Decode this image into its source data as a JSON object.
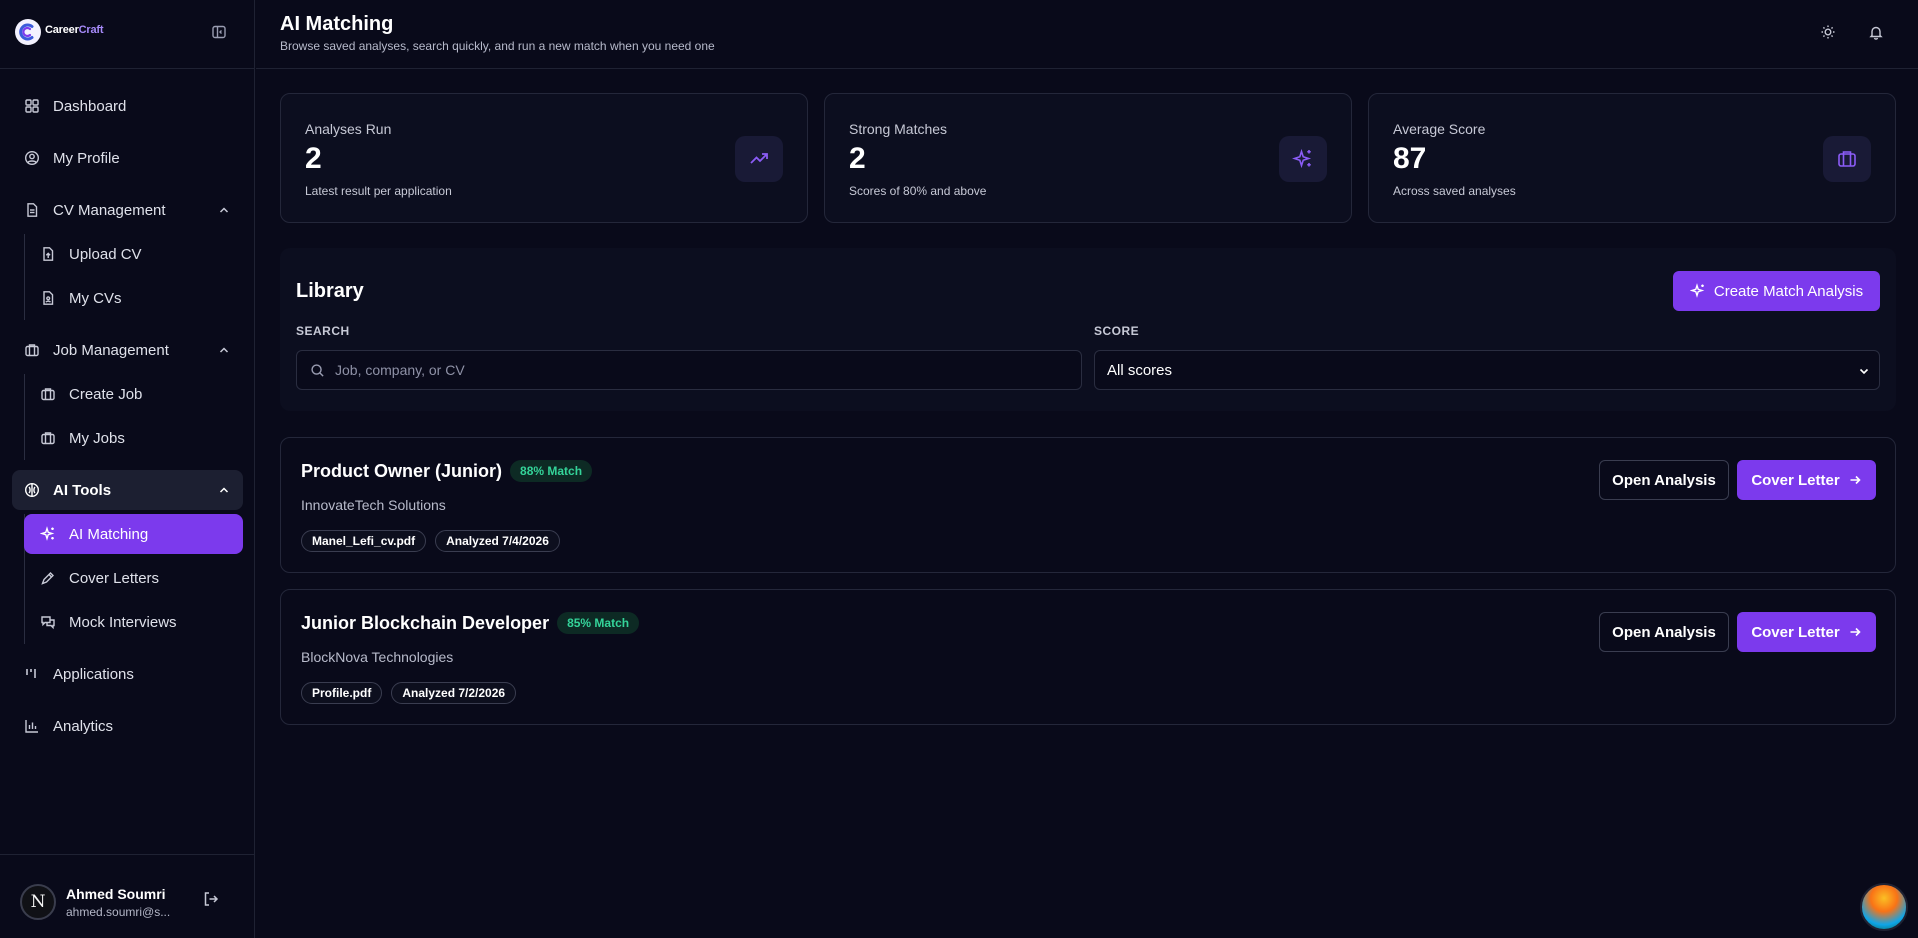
{
  "app": {
    "brand_prefix": "Career",
    "brand_suffix": "Craft",
    "brand_tagline": ""
  },
  "sidebar": {
    "dashboard": "Dashboard",
    "profile": "My Profile",
    "cv_group": "CV Management",
    "upload_cv": "Upload CV",
    "my_cvs": "My CVs",
    "job_group": "Job Management",
    "create_job": "Create Job",
    "my_jobs": "My Jobs",
    "ai_group": "AI Tools",
    "ai_matching": "AI Matching",
    "cover_letters": "Cover Letters",
    "mock_interviews": "Mock Interviews",
    "applications": "Applications",
    "analytics": "Analytics"
  },
  "user": {
    "initial": "N",
    "name": "Ahmed Soumri",
    "email": "ahmed.soumri@s..."
  },
  "header": {
    "title": "AI Matching",
    "subtitle": "Browse saved analyses, search quickly, and run a new match when you need one"
  },
  "stats": [
    {
      "label": "Analyses Run",
      "value": "2",
      "sub": "Latest result per application",
      "icon": "trending-up-icon"
    },
    {
      "label": "Strong Matches",
      "value": "2",
      "sub": "Scores of 80% and above",
      "icon": "sparkles-icon"
    },
    {
      "label": "Average Score",
      "value": "87",
      "sub": "Across saved analyses",
      "icon": "briefcase-icon"
    }
  ],
  "library": {
    "title": "Library",
    "create_button": "Create Match Analysis",
    "search_label": "SEARCH",
    "search_placeholder": "Job, company, or CV",
    "score_label": "SCORE",
    "score_value": "All scores"
  },
  "results": [
    {
      "title": "Product Owner (Junior)",
      "match": "88% Match",
      "company": "InnovateTech Solutions",
      "file": "Manel_Lefi_cv.pdf",
      "analyzed": "Analyzed 7/4/2026",
      "open_label": "Open Analysis",
      "cover_label": "Cover Letter"
    },
    {
      "title": "Junior Blockchain Developer",
      "match": "85% Match",
      "company": "BlockNova Technologies",
      "file": "Profile.pdf",
      "analyzed": "Analyzed 7/2/2026",
      "open_label": "Open Analysis",
      "cover_label": "Cover Letter"
    }
  ],
  "colors": {
    "accent": "#7c3aed",
    "background": "#090a1a",
    "match_green": "#34d399"
  }
}
